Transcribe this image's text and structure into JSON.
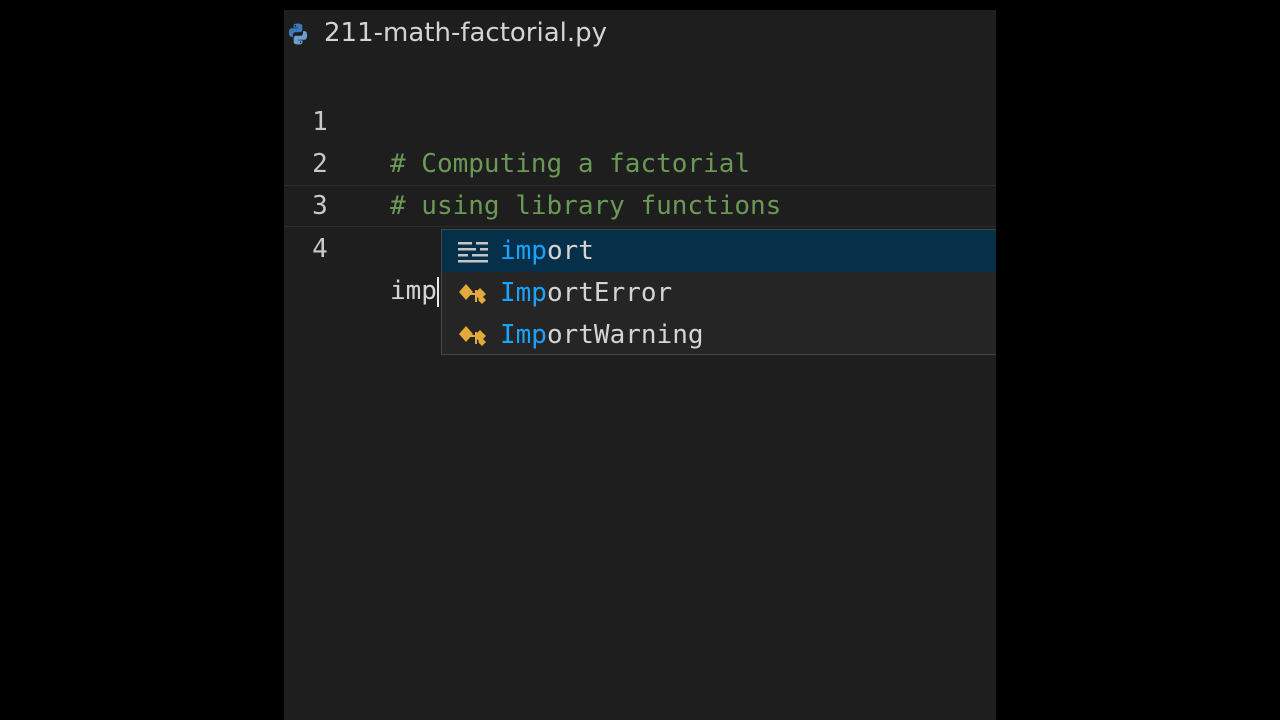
{
  "tab": {
    "title": "211-math-factorial.py",
    "icon": "python-icon"
  },
  "editor": {
    "lines": [
      {
        "number": "1",
        "text": "# Computing a factorial"
      },
      {
        "number": "2",
        "text": "# using library functions"
      },
      {
        "number": "3",
        "text": ""
      },
      {
        "number": "4",
        "text": "imp"
      }
    ]
  },
  "suggestions": [
    {
      "match": "imp",
      "rest": "ort",
      "icon": "keyword-icon",
      "selected": true
    },
    {
      "match": "Imp",
      "rest": "ortError",
      "icon": "class-icon",
      "selected": false
    },
    {
      "match": "Imp",
      "rest": "ortWarning",
      "icon": "class-icon",
      "selected": false
    }
  ],
  "colors": {
    "comment": "#6a9955",
    "match": "#18a3ff",
    "selection": "#062f4a",
    "class_icon": "#e2a93b"
  }
}
